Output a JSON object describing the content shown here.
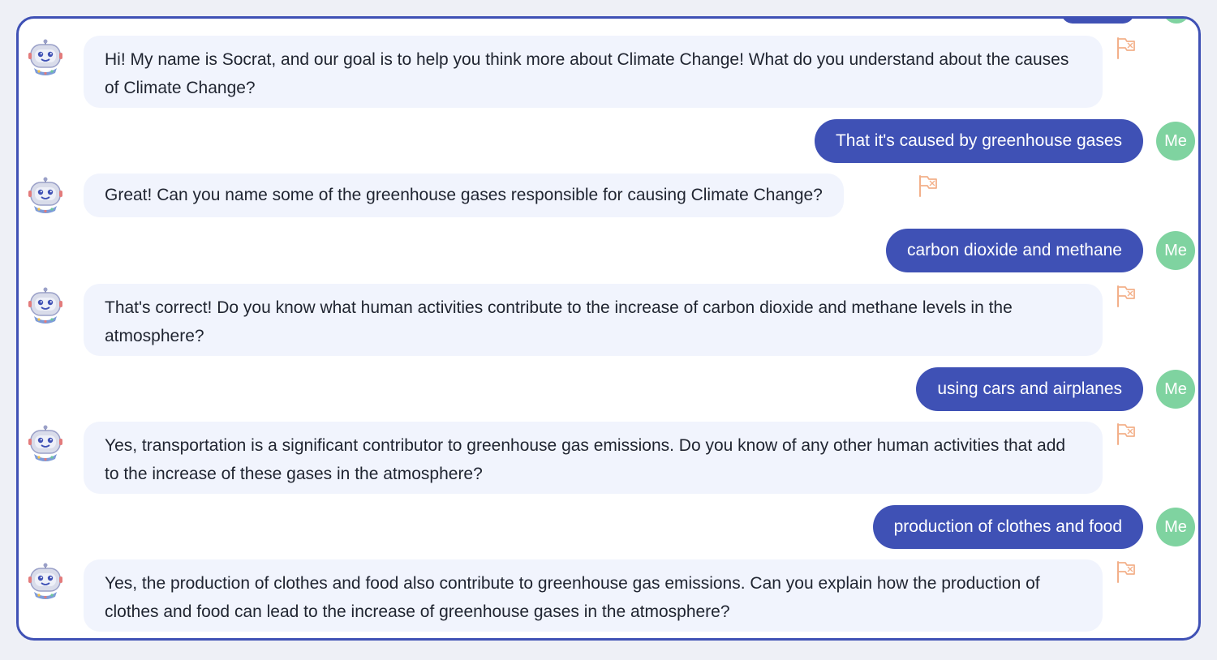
{
  "colors": {
    "frame_border": "#3f51b5",
    "bot_bubble": "#f1f4fd",
    "user_bubble": "#3f51b5",
    "me_avatar": "#7fd3a0",
    "flag": "#f3b08a"
  },
  "icons": {
    "bot_avatar": "robot-avatar-icon",
    "report": "flag-icon"
  },
  "user_avatar_label": "Me",
  "messages": [
    {
      "role": "bot",
      "text": "Hi! My name is Socrat, and our goal is to help you think more about Climate Change! What do you understand about the causes of Climate Change?"
    },
    {
      "role": "user",
      "text": "That it's caused by greenhouse gases"
    },
    {
      "role": "bot",
      "text": "Great! Can you name some of the greenhouse gases responsible for causing Climate Change?"
    },
    {
      "role": "user",
      "text": "carbon dioxide and methane"
    },
    {
      "role": "bot",
      "text": "That's correct! Do you know what human activities contribute to the increase of carbon dioxide and methane levels in the atmosphere?"
    },
    {
      "role": "user",
      "text": "using cars and airplanes"
    },
    {
      "role": "bot",
      "text": "Yes, transportation is a significant contributor to greenhouse gas emissions. Do you know of any other human activities that add to the increase of these gases in the atmosphere?"
    },
    {
      "role": "user",
      "text": "production of clothes and food"
    },
    {
      "role": "bot",
      "text": "Yes, the production of clothes and food also contribute to greenhouse gas emissions. Can you explain how the production of clothes and food can lead to the increase of greenhouse gases in the atmosphere?"
    }
  ]
}
